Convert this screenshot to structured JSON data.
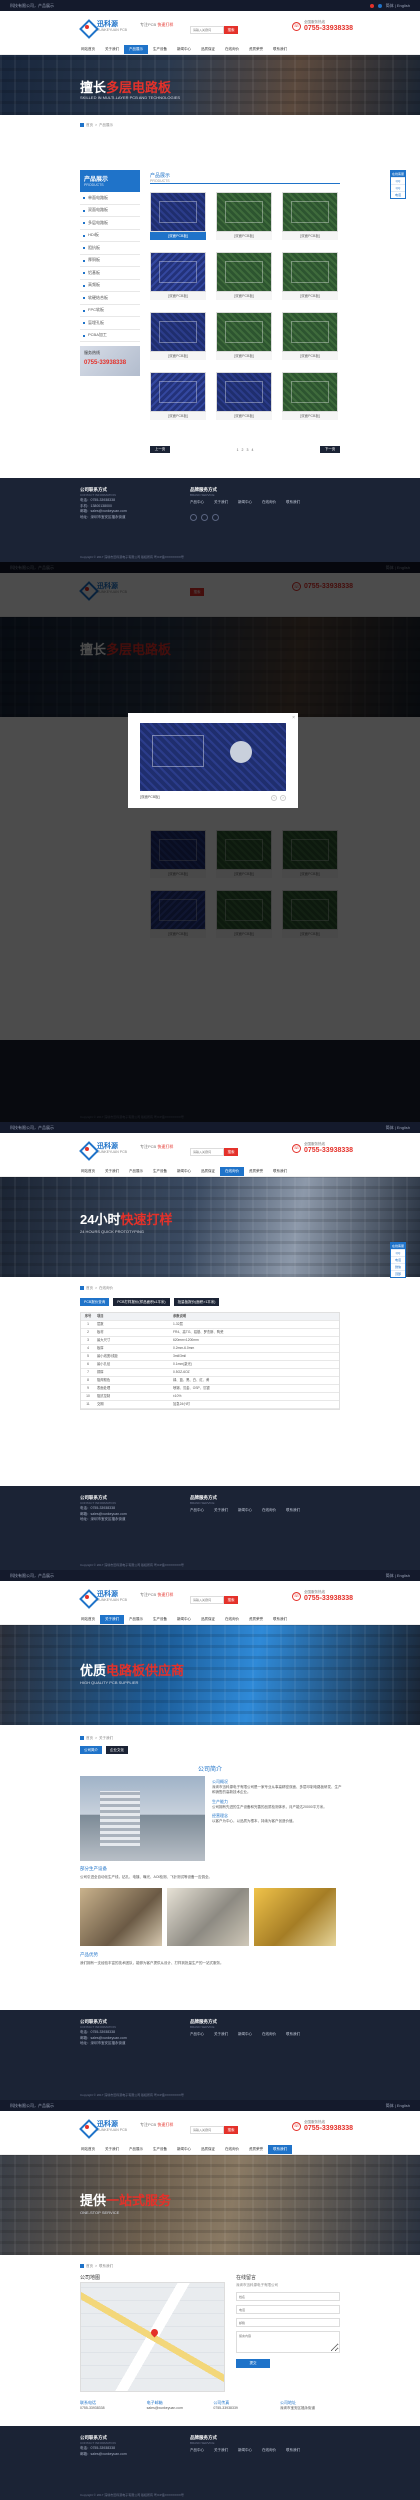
{
  "topbar": {
    "left": "科技有限公司，产品展示",
    "right": "简体 | English"
  },
  "header": {
    "logo_cn": "迅科源",
    "logo_en": "XUNKEYUAN PCB",
    "slogan_a": "专注PCB",
    "slogan_b": "快速打样",
    "search_placeholder": "请输入关键词",
    "search_label": "搜索",
    "hotline_label": "全国服务热线",
    "hotline_number": "0755-33938338"
  },
  "nav": [
    "网站首页",
    "关于我们",
    "产品展示",
    "生产设备",
    "新闻中心",
    "品质保证",
    "在线询价",
    "资质荣誉",
    "联系我们"
  ],
  "banners": {
    "b1": {
      "a": "擅长",
      "b": "多层电路板",
      "sub": "SKILLED IN MULTI-LAYER PCB AND TECHNOLOGIES"
    },
    "b3": {
      "a": "24小时",
      "b": "快速打样",
      "sub": "24 HOURS QUICK PROTOTYPING"
    },
    "b4": {
      "a": "优质",
      "b": "电路板供应商",
      "sub": "HIGH QUALITY PCB SUPPLIER"
    },
    "b5": {
      "a": "提供",
      "b": "一站式服务",
      "sub": "ONE-STOP SERVICE"
    }
  },
  "crumb": {
    "home": "首页",
    "sep": ">",
    "products": "产品展示",
    "about": "关于我们",
    "contact": "联系我们",
    "quote": "在线询价"
  },
  "sidebar": {
    "title": "产品展示",
    "title_en": "PRODUCTS",
    "items": [
      "单面电路板",
      "双面电路板",
      "多层电路板",
      "HDI板",
      "阻抗板",
      "厚铜板",
      "铝基板",
      "高频板",
      "软硬结合板",
      "FPC软板",
      "盲埋孔板",
      "PCBA加工"
    ],
    "contact_title": "服务热线",
    "contact_num": "0755-33938338"
  },
  "products": {
    "title": "产品展示",
    "title_en": "PRODUCTS",
    "caption": "[双面PCB板]",
    "prev": "上一页",
    "next": "下一页",
    "pages": [
      "1",
      "2",
      "3",
      "4"
    ]
  },
  "modal": {
    "caption": "[双面PCB板]",
    "close": "×",
    "prev": "‹",
    "next": "›"
  },
  "quote": {
    "tabs": [
      "PCB报价查询",
      "PCB打样报价(样品面积≤1平米)",
      "批量板报价(面积>1平米)"
    ],
    "headers": [
      "序号",
      "项目",
      "参数说明"
    ],
    "rows": [
      [
        "1",
        "层数",
        "1-32层"
      ],
      [
        "2",
        "板材",
        "FR4、高TG、铝基、罗杰斯、陶瓷"
      ],
      [
        "3",
        "最大尺寸",
        "620mm×1200mm"
      ],
      [
        "4",
        "板厚",
        "0.2mm-6.0mm"
      ],
      [
        "5",
        "最小线宽/线距",
        "3mil/3mil"
      ],
      [
        "6",
        "最小孔径",
        "0.1mm(激光)"
      ],
      [
        "7",
        "铜厚",
        "0.5OZ-6OZ"
      ],
      [
        "8",
        "阻焊颜色",
        "绿、蓝、黑、白、红、黄"
      ],
      [
        "9",
        "表面处理",
        "喷锡、沉金、OSP、沉银"
      ],
      [
        "10",
        "阻抗控制",
        "±10%"
      ],
      [
        "11",
        "交期",
        "加急24小时"
      ]
    ]
  },
  "about": {
    "tabs": [
      "公司简介",
      "企业文化"
    ],
    "title": "公司简介",
    "h1": "公司概况",
    "t1": "深圳市迅科源电子有限公司是一家专业从事高精密双面、多层印制电路板研发、生产和销售的高新技术企业。",
    "h2": "生产能力",
    "t2": "公司拥有先进的生产设备和完善的品质检测体系，月产能达20000平方米。",
    "h3": "经营理念",
    "t3": "以客户为中心，以品质为根本，持续为客户创造价值。",
    "sec1_title": "部分生产设备",
    "sec1_text": "公司引进全自动化生产线，钻孔、电镀、曝光、AOI检测、飞针测试等设备一应俱全。",
    "sec2_title": "产品优势",
    "sec2_text": "我们拥有一支经验丰富的技术团队，能够为客户提供从设计、打样到批量生产的一站式服务。"
  },
  "contact": {
    "map_title": "公司地图",
    "form_title": "在线留言",
    "form_sub": "深圳市迅科源电子有限公司",
    "name_ph": "姓名",
    "phone_ph": "电话",
    "email_ph": "邮箱",
    "msg_ph": "留言内容",
    "submit": "提交",
    "items": [
      {
        "t": "联系电话",
        "v": "0755-33938338"
      },
      {
        "t": "电子邮箱",
        "v": "sales@xunkeyuan.com"
      },
      {
        "t": "公司传真",
        "v": "0755-33938339"
      },
      {
        "t": "公司地址",
        "v": "深圳市宝安区福永街道"
      }
    ]
  },
  "footer": {
    "col1_title": "公司联系方式",
    "col1_en": "CONTACT INFORMATION",
    "phone": "电话：0755-33938338",
    "mobile": "手机：13800138000",
    "email": "邮箱：sales@xunkeyuan.com",
    "address": "地址：深圳市宝安区福永街道",
    "col2_title": "品牌服务方式",
    "col2_en": "BRAND SERVICE",
    "links": [
      "产品中心",
      "关于我们",
      "新闻中心",
      "在线询价",
      "联系我们"
    ],
    "copyright": "Copyright © 2017 深圳市迅科源电子有限公司 版权所有 粤ICP备XXXXXXXX号"
  },
  "float": {
    "title": "在线客服",
    "items": [
      "QQ",
      "QQ",
      "电话",
      "微信",
      "顶部"
    ]
  }
}
